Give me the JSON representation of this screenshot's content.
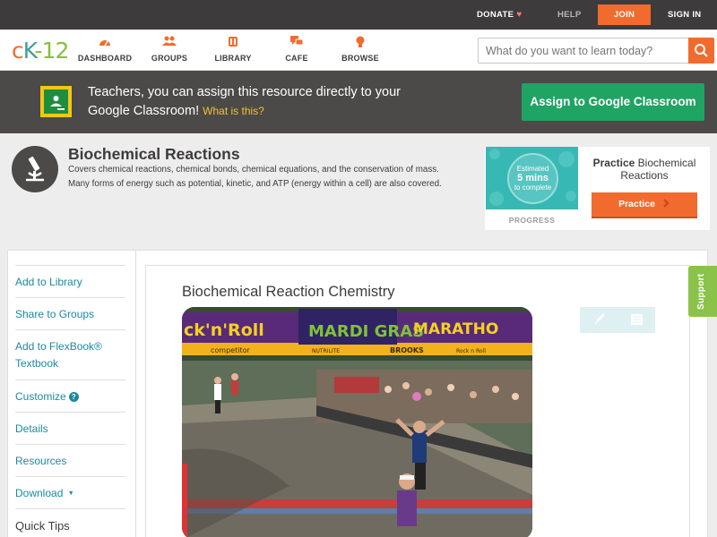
{
  "topbar": {
    "donate": "DONATE",
    "help": "HELP",
    "join": "JOIN",
    "signin": "SIGN IN"
  },
  "nav": {
    "logo": {
      "c": "c",
      "k": "K",
      "dash": "-",
      "num": "12"
    },
    "items": [
      {
        "label": "DASHBOARD",
        "icon": "gauge-icon"
      },
      {
        "label": "GROUPS",
        "icon": "people-icon"
      },
      {
        "label": "LIBRARY",
        "icon": "books-icon"
      },
      {
        "label": "CAFE",
        "icon": "chat-bubbles-icon"
      },
      {
        "label": "BROWSE",
        "icon": "lightbulb-icon"
      }
    ],
    "search_placeholder": "What do you want to learn today?"
  },
  "classroom_banner": {
    "text": "Teachers, you can assign this resource directly to your Google Classroom!",
    "what_is_this": "What is this?",
    "button": "Assign to Google Classroom"
  },
  "concept": {
    "title": "Biochemical Reactions",
    "description": "Covers chemical reactions, chemical bonds, chemical equations, and the conservation of mass. Many forms of energy such as potential, kinetic, and ATP (energy within a cell) are also covered."
  },
  "practice": {
    "estimate_line1": "Estimated",
    "estimate_line2": "5 mins",
    "estimate_line3": "to complete",
    "progress_label": "PROGRESS",
    "title_bold": "Practice",
    "title_rest": "Biochemical Reactions",
    "button": "Practice"
  },
  "sidebar": {
    "items": [
      {
        "label": "Add to Library"
      },
      {
        "label": "Share to Groups"
      },
      {
        "label": "Add to FlexBook® Textbook"
      },
      {
        "label": "Customize"
      },
      {
        "label": "Details"
      },
      {
        "label": "Resources"
      },
      {
        "label": "Download"
      },
      {
        "label": "Quick Tips"
      }
    ],
    "customize_help": "?",
    "download_caret": "▼"
  },
  "article": {
    "title": "Biochemical Reaction Chemistry",
    "image_banner_left": "ck'n'Roll",
    "image_banner_main": "MARDI GRAS",
    "image_banner_right": "MARATHO",
    "image_sponsor_1": "competitor",
    "image_sponsor_2": "NUTRILITE",
    "image_sponsor_3": "BROOKS",
    "image_sponsor_4": "Rock n Roll"
  },
  "support": "Support",
  "colors": {
    "accent_orange": "#f26b2e",
    "teal_link": "#1c8a9d",
    "classroom_green": "#1fa463",
    "support_green": "#8bc34a",
    "dark_bar": "#3d3b3b"
  }
}
